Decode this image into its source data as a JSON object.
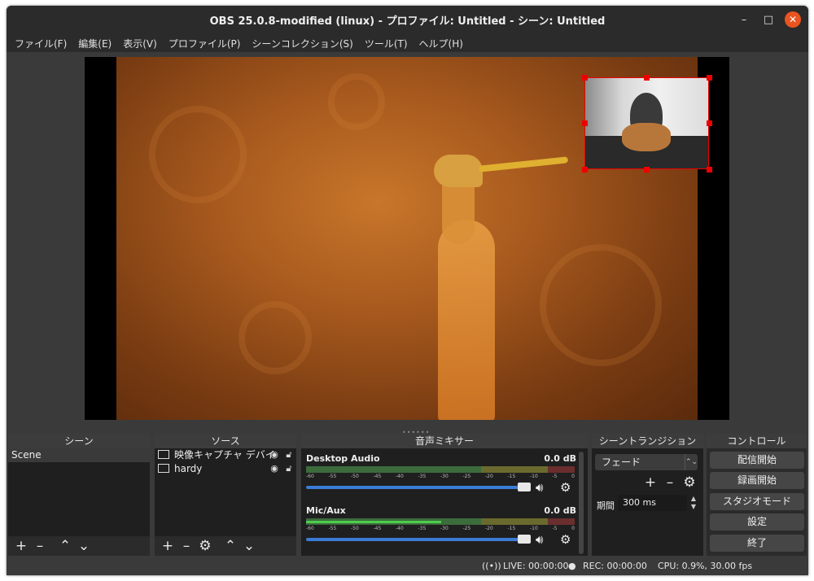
{
  "window": {
    "title": "OBS 25.0.8-modified (linux) - プロファイル: Untitled - シーン: Untitled",
    "minimize": "–",
    "maximize": "□",
    "close": "✕"
  },
  "menu": [
    "ファイル(F)",
    "編集(E)",
    "表示(V)",
    "プロファイル(P)",
    "シーンコレクション(S)",
    "ツール(T)",
    "ヘルプ(H)"
  ],
  "docks": {
    "scenes": {
      "title": "シーン",
      "items": [
        "Scene"
      ]
    },
    "sources": {
      "title": "ソース",
      "items": [
        {
          "name": "映像キャプチャ デバイ",
          "icon": "camera-icon"
        },
        {
          "name": "hardy",
          "icon": "image-icon"
        }
      ]
    },
    "mixer": {
      "title": "音声ミキサー",
      "channels": [
        {
          "name": "Desktop Audio",
          "db": "0.0 dB",
          "level": 0
        },
        {
          "name": "Mic/Aux",
          "db": "0.0 dB",
          "level": 0.5
        }
      ],
      "ticks": [
        "-60",
        "-55",
        "-50",
        "-45",
        "-40",
        "-35",
        "-30",
        "-25",
        "-20",
        "-15",
        "-10",
        "-5",
        "0"
      ]
    },
    "transitions": {
      "title": "シーントランジション",
      "selected": "フェード",
      "duration_label": "期間",
      "duration_value": "300 ms"
    },
    "controls": {
      "title": "コントロール",
      "buttons": [
        "配信開始",
        "録画開始",
        "スタジオモード",
        "設定",
        "終了"
      ]
    }
  },
  "status": {
    "live": "LIVE: 00:00:00",
    "rec": "REC: 00:00:00",
    "cpu": "CPU: 0.9%, 30.00 fps"
  },
  "colors": {
    "accent": "#e95420",
    "selection": "#ff0000",
    "slider": "#3a7bd5",
    "meter_green": "#4ecc4e"
  }
}
